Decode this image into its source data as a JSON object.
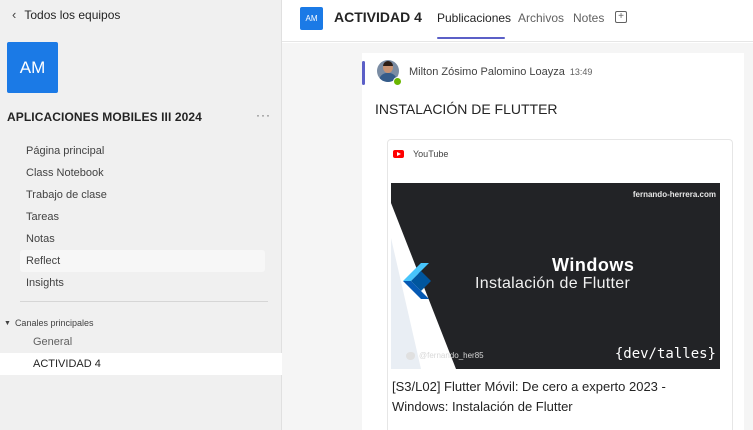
{
  "sidebar": {
    "back_label": "Todos los equipos",
    "team_avatar": "AM",
    "team_name": "APLICACIONES MOBILES III 2024",
    "more": "···",
    "nav_items": [
      {
        "label": "Página principal"
      },
      {
        "label": "Class Notebook"
      },
      {
        "label": "Trabajo de clase"
      },
      {
        "label": "Tareas"
      },
      {
        "label": "Notas"
      },
      {
        "label": "Reflect"
      },
      {
        "label": "Insights"
      }
    ],
    "channels_header": "Canales principales",
    "channels": [
      {
        "label": "General"
      },
      {
        "label": "ACTIVIDAD 4"
      }
    ]
  },
  "header": {
    "avatar": "AM",
    "title": "ACTIVIDAD 4",
    "tabs": [
      {
        "label": "Publicaciones"
      },
      {
        "label": "Archivos"
      },
      {
        "label": "Notes"
      }
    ],
    "add_tab": "+"
  },
  "post": {
    "author": "Milton Zósimo Palomino Loayza",
    "time": "13:49",
    "title": "INSTALACIÓN DE FLUTTER",
    "card": {
      "source": "YouTube",
      "thumbnail": {
        "url": "fernando-herrera.com",
        "heading": "Windows",
        "subheading": "Instalación de Flutter",
        "handle": "@fernando_her85",
        "brand": "{dev/talles}"
      },
      "video_title": "[S3/L02] Flutter Móvil: De cero a experto 2023 - Windows: Instalación de Flutter"
    }
  },
  "colors": {
    "accent": "#5b5fc7",
    "team_avatar": "#1b7ae6",
    "presence": "#6bb700",
    "youtube": "#ff0000"
  }
}
